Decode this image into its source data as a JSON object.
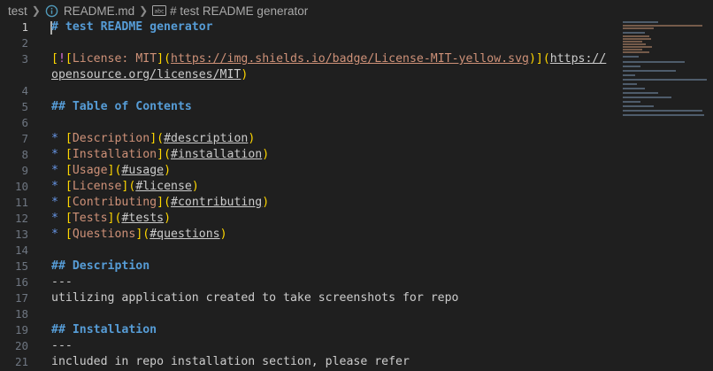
{
  "breadcrumb": {
    "folder": "test",
    "file": "README.md",
    "symbol_icon": "abc",
    "symbol": "# test README generator"
  },
  "editor": {
    "active_line": 1,
    "lines": [
      {
        "n": "1",
        "segments": [
          {
            "c": "h",
            "t": "# test README generator"
          }
        ]
      },
      {
        "n": "2",
        "segments": []
      },
      {
        "n": "3",
        "segments": [
          {
            "c": "bracket",
            "t": "["
          },
          {
            "c": "bang",
            "t": "!"
          },
          {
            "c": "bracket",
            "t": "["
          },
          {
            "c": "linktext",
            "t": "License: MIT"
          },
          {
            "c": "bracket",
            "t": "]("
          },
          {
            "c": "url",
            "t": "https://img.shields.io/badge/License-MIT-yellow.svg"
          },
          {
            "c": "bracket",
            "t": ")"
          },
          {
            "c": "bracket",
            "t": "]("
          },
          {
            "c": "urlw",
            "t": "https://"
          }
        ]
      },
      {
        "n": "",
        "segments": [
          {
            "c": "urlw",
            "t": "opensource.org/licenses/MIT"
          },
          {
            "c": "bracket",
            "t": ")"
          }
        ]
      },
      {
        "n": "4",
        "segments": []
      },
      {
        "n": "5",
        "segments": [
          {
            "c": "h",
            "t": "## Table of Contents"
          }
        ]
      },
      {
        "n": "6",
        "segments": []
      },
      {
        "n": "7",
        "segments": [
          {
            "c": "bullet",
            "t": "* "
          },
          {
            "c": "bracket",
            "t": "["
          },
          {
            "c": "linktext",
            "t": "Description"
          },
          {
            "c": "bracket",
            "t": "]("
          },
          {
            "c": "urlw",
            "t": "#description"
          },
          {
            "c": "bracket",
            "t": ")"
          }
        ]
      },
      {
        "n": "8",
        "segments": [
          {
            "c": "bullet",
            "t": "* "
          },
          {
            "c": "bracket",
            "t": "["
          },
          {
            "c": "linktext",
            "t": "Installation"
          },
          {
            "c": "bracket",
            "t": "]("
          },
          {
            "c": "urlw",
            "t": "#installation"
          },
          {
            "c": "bracket",
            "t": ")"
          }
        ]
      },
      {
        "n": "9",
        "segments": [
          {
            "c": "bullet",
            "t": "* "
          },
          {
            "c": "bracket",
            "t": "["
          },
          {
            "c": "linktext",
            "t": "Usage"
          },
          {
            "c": "bracket",
            "t": "]("
          },
          {
            "c": "urlw",
            "t": "#usage"
          },
          {
            "c": "bracket",
            "t": ")"
          }
        ]
      },
      {
        "n": "10",
        "segments": [
          {
            "c": "bullet",
            "t": "* "
          },
          {
            "c": "bracket",
            "t": "["
          },
          {
            "c": "linktext",
            "t": "License"
          },
          {
            "c": "bracket",
            "t": "]("
          },
          {
            "c": "urlw",
            "t": "#license"
          },
          {
            "c": "bracket",
            "t": ")"
          }
        ]
      },
      {
        "n": "11",
        "segments": [
          {
            "c": "bullet",
            "t": "* "
          },
          {
            "c": "bracket",
            "t": "["
          },
          {
            "c": "linktext",
            "t": "Contributing"
          },
          {
            "c": "bracket",
            "t": "]("
          },
          {
            "c": "urlw",
            "t": "#contributing"
          },
          {
            "c": "bracket",
            "t": ")"
          }
        ]
      },
      {
        "n": "12",
        "segments": [
          {
            "c": "bullet",
            "t": "* "
          },
          {
            "c": "bracket",
            "t": "["
          },
          {
            "c": "linktext",
            "t": "Tests"
          },
          {
            "c": "bracket",
            "t": "]("
          },
          {
            "c": "urlw",
            "t": "#tests"
          },
          {
            "c": "bracket",
            "t": ")"
          }
        ]
      },
      {
        "n": "13",
        "segments": [
          {
            "c": "bullet",
            "t": "* "
          },
          {
            "c": "bracket",
            "t": "["
          },
          {
            "c": "linktext",
            "t": "Questions"
          },
          {
            "c": "bracket",
            "t": "]("
          },
          {
            "c": "urlw",
            "t": "#questions"
          },
          {
            "c": "bracket",
            "t": ")"
          }
        ]
      },
      {
        "n": "14",
        "segments": []
      },
      {
        "n": "15",
        "segments": [
          {
            "c": "h",
            "t": "## Description"
          }
        ]
      },
      {
        "n": "16",
        "segments": [
          {
            "c": "hr",
            "t": "---"
          }
        ]
      },
      {
        "n": "17",
        "segments": [
          {
            "c": "plain",
            "t": "utilizing application created to take screenshots for repo"
          }
        ]
      },
      {
        "n": "18",
        "segments": []
      },
      {
        "n": "19",
        "segments": [
          {
            "c": "h",
            "t": "## Installation"
          }
        ]
      },
      {
        "n": "20",
        "segments": [
          {
            "c": "hr",
            "t": "---"
          }
        ]
      },
      {
        "n": "21",
        "segments": [
          {
            "c": "plain",
            "t": "included in repo installation section, please refer"
          }
        ]
      }
    ]
  },
  "colors": {
    "background": "#1f1f1f",
    "heading": "#569cd6",
    "bracket": "#ffd700",
    "link_text": "#ce9178",
    "bullet": "#6796e6"
  }
}
